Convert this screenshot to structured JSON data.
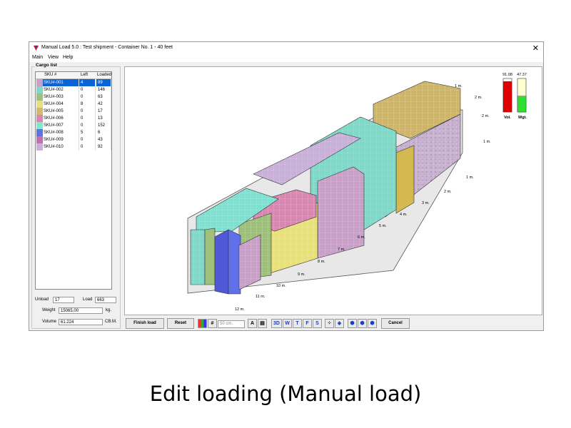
{
  "window": {
    "title": "Manual Load 5.0 : Test shipment - Container No. 1 - 40 feet",
    "close": "✕"
  },
  "menu": [
    "Main",
    "View",
    "Help"
  ],
  "cargo": {
    "group_label": "Cargo list",
    "headers": [
      "SKU #",
      "Left",
      "Loaded"
    ],
    "rows": [
      {
        "sku": "SKU#-001",
        "left": "4",
        "loaded": "89",
        "color": "#c8a0c8",
        "selected": true
      },
      {
        "sku": "SKU#-002",
        "left": "0",
        "loaded": "146",
        "color": "#7fd8c8"
      },
      {
        "sku": "SKU#-003",
        "left": "0",
        "loaded": "63",
        "color": "#9ec07a"
      },
      {
        "sku": "SKU#-004",
        "left": "8",
        "loaded": "42",
        "color": "#e8e07a"
      },
      {
        "sku": "SKU#-005",
        "left": "0",
        "loaded": "17",
        "color": "#d4b870"
      },
      {
        "sku": "SKU#-006",
        "left": "0",
        "loaded": "13",
        "color": "#d888b0"
      },
      {
        "sku": "SKU#-007",
        "left": "0",
        "loaded": "152",
        "color": "#80e8d0"
      },
      {
        "sku": "SKU#-008",
        "left": "5",
        "loaded": "6",
        "color": "#6070e0"
      },
      {
        "sku": "SKU#-009",
        "left": "0",
        "loaded": "43",
        "color": "#c070b0"
      },
      {
        "sku": "SKU#-010",
        "left": "0",
        "loaded": "92",
        "color": "#c8b0d8"
      }
    ]
  },
  "summary": {
    "unload_label": "Unload",
    "unload": "17",
    "load_label": "Load",
    "load": "663",
    "weight_label": "Weight",
    "weight": "15065.00",
    "weight_unit": "kg.",
    "volume_label": "Volume",
    "volume": "61.224",
    "volume_unit": "CB.M."
  },
  "gauges": {
    "vol_label": "Vol.",
    "vol_value": "91.08",
    "vol_fraction": 0.9108,
    "vol_color": "#e00000",
    "wgt_label": "Wgt.",
    "wgt_value": "47.37",
    "wgt_fraction": 0.4737,
    "wgt_color": "#30e030"
  },
  "distances": [
    "1 m.",
    "2 m.",
    "2 m.",
    "1 m.",
    "1 m.",
    "2 m.",
    "3 m.",
    "4 m.",
    "5 m.",
    "6 m.",
    "7 m.",
    "8 m.",
    "9 m.",
    "10 m.",
    "11 m.",
    "12 m."
  ],
  "toolbar": {
    "finish": "Finish load",
    "reset": "Reset",
    "grid_size": "50 cm.",
    "view_3d": "3D",
    "view_w": "W",
    "view_t": "T",
    "view_f": "F",
    "view_s": "S",
    "cancel": "Cancel"
  },
  "caption": "Edit loading (Manual load)"
}
